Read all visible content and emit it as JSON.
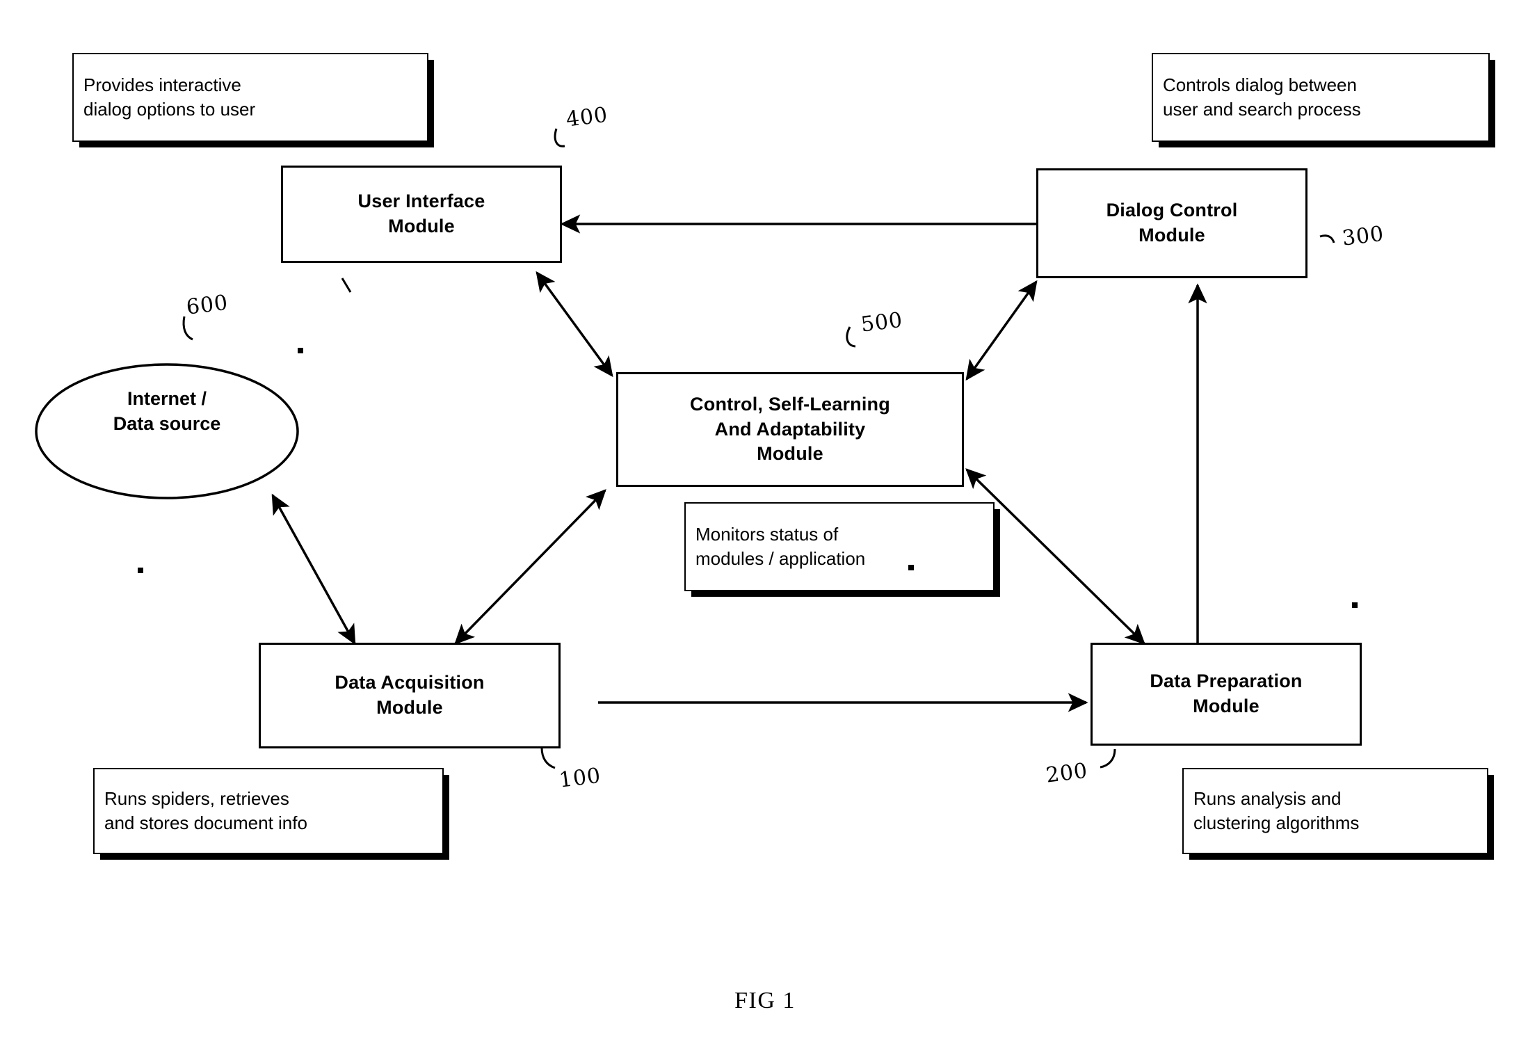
{
  "figure": {
    "caption": "FIG 1"
  },
  "modules": [
    {
      "id": "user-interface-module",
      "label": "User Interface\nModule",
      "ref": "400"
    },
    {
      "id": "dialog-control-module",
      "label": "Dialog Control\nModule",
      "ref": "300"
    },
    {
      "id": "control-self-learning-module",
      "label": "Control, Self-Learning\nAnd Adaptability\nModule",
      "ref": "500"
    },
    {
      "id": "data-acquisition-module",
      "label": "Data Acquisition\nModule",
      "ref": "100"
    },
    {
      "id": "data-preparation-module",
      "label": "Data Preparation\nModule",
      "ref": "200"
    }
  ],
  "datasource": {
    "label": "Internet /\nData source",
    "ref": "600"
  },
  "annotations": [
    {
      "id": "ui-annotation",
      "text": "Provides interactive\ndialog options to user"
    },
    {
      "id": "dialog-annotation",
      "text": "Controls dialog between\nuser and search process"
    },
    {
      "id": "control-annotation",
      "text": "Monitors status of\nmodules / application"
    },
    {
      "id": "acquisition-annotation",
      "text": "Runs spiders, retrieves\nand stores document info"
    },
    {
      "id": "preparation-annotation",
      "text": "Runs analysis and\nclustering algorithms"
    }
  ]
}
